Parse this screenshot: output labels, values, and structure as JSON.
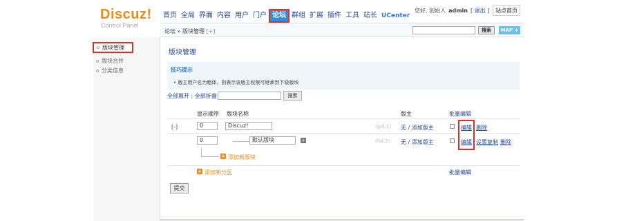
{
  "header": {
    "logo": "Discuz!",
    "subtitle": "Control Panel",
    "nav": [
      {
        "label": "首页"
      },
      {
        "label": "全局"
      },
      {
        "label": "界面"
      },
      {
        "label": "内容"
      },
      {
        "label": "用户"
      },
      {
        "label": "门户"
      },
      {
        "label": "论坛",
        "active": true
      },
      {
        "label": "群组"
      },
      {
        "label": "扩展"
      },
      {
        "label": "插件"
      },
      {
        "label": "工具"
      },
      {
        "label": "站长"
      },
      {
        "label": "UCenter"
      }
    ],
    "greeting": "您好, 创始人",
    "username": "admin",
    "logout": "[ 退出 ]",
    "home_button": "站点首页"
  },
  "crumbbar": {
    "breadcrumb": "论坛 » 版块管理",
    "add": "[+]",
    "search_button": "搜索",
    "map_button": "MAP +"
  },
  "sidebar": {
    "items": [
      {
        "label": "版块管理",
        "selected": true
      },
      {
        "label": "版块合并"
      },
      {
        "label": "分类信息"
      }
    ]
  },
  "main": {
    "title": "版块管理",
    "tips_title": "技巧提示",
    "tips_text": "• 版主用户名为粗体，则表示该版主权限可继承到下级版块",
    "expand_all": "全部展开",
    "collapse_all": "全部折叠",
    "search_button": "搜索",
    "columns": {
      "order": "显示顺序",
      "name": "版块名称",
      "moderator": "版主",
      "batch": "批量编辑"
    },
    "rows": [
      {
        "toggle": "[-]",
        "order": "0",
        "name": "Discuz!",
        "id": "(gid:1)",
        "moderators": "无 / 添加版主",
        "links": [
          "编辑",
          "删除"
        ]
      },
      {
        "order": "0",
        "name": "默认版块",
        "id": "(fid:2)",
        "moderators": "无 / 添加版主",
        "links": [
          "编辑",
          "设置复制",
          "删除"
        ]
      }
    ],
    "add_forum": "添加新版块",
    "add_category": "添加新分区",
    "batch_footer": "批量编辑",
    "submit": "提交"
  },
  "colors": {
    "accent": "#2f8fd8",
    "logo": "#f08a16",
    "highlight": "#d9312a",
    "link": "#25489a"
  }
}
